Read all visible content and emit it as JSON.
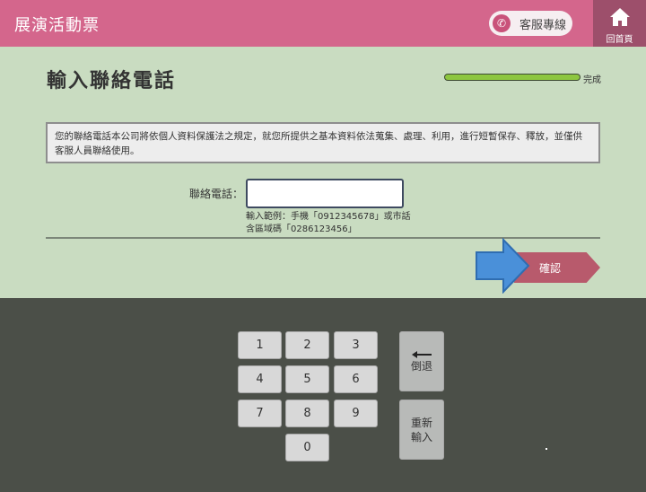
{
  "header": {
    "title": "展演活動票",
    "service_label": "客服專線",
    "home_label": "回首頁"
  },
  "main": {
    "title": "輸入聯絡電話",
    "progress": {
      "value": 1.0,
      "label": "完成"
    },
    "notice": "您的聯絡電話本公司將依個人資料保護法之規定，就您所提供之基本資料依法蒐集、處理、利用，進行短暫保存、釋放，並僅供客服人員聯絡使用。",
    "phone_label": "聯絡電話：",
    "phone_value": "",
    "hint_line1": "輸入範例：手機「0912345678」或市話",
    "hint_line2": "含區域碼「0286123456」",
    "confirm_label": "確認"
  },
  "keypad": {
    "keys": [
      "1",
      "2",
      "3",
      "4",
      "5",
      "6",
      "7",
      "8",
      "9",
      "0"
    ],
    "backspace_label": "倒退",
    "reset_line1": "重新",
    "reset_line2": "輸入"
  },
  "colors": {
    "header": "#d4668c",
    "panel": "#c9dcc1",
    "keypad_bg": "#4b4f48",
    "confirm": "#b85a6c",
    "progress": "#8dc63f",
    "arrow": "#4a90d9"
  },
  "icons": {
    "service": "phone-icon",
    "home": "home-icon",
    "pointer": "arrow-right-icon",
    "backspace": "arrow-left-icon"
  }
}
